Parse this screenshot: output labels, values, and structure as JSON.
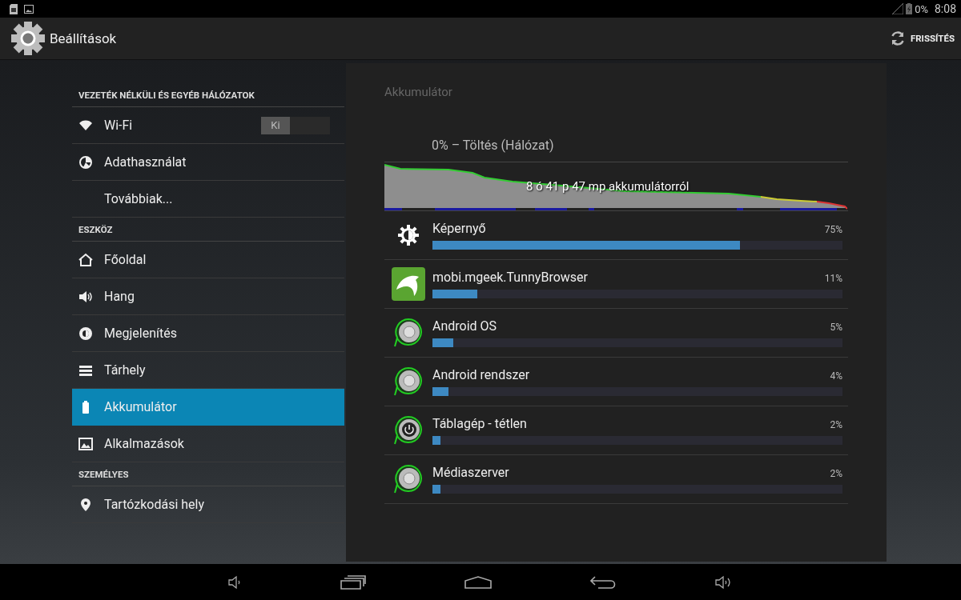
{
  "status_bar": {
    "battery_text": "0%",
    "time": "8:08"
  },
  "action_bar": {
    "title": "Beállítások",
    "action": "FRISSÍTÉS"
  },
  "sidebar": {
    "items": [
      {
        "kind": "header",
        "label": "VEZETÉK NÉLKÜLI ÉS EGYÉB HÁLÓZATOK"
      },
      {
        "kind": "item",
        "label": "Wi-Fi",
        "selected": false,
        "toggle": {
          "label": "Ki",
          "on": false
        }
      },
      {
        "kind": "item",
        "label": "Adathasználat",
        "selected": false
      },
      {
        "kind": "item",
        "label": "Továbbiak...",
        "selected": false
      },
      {
        "kind": "header",
        "label": "ESZKÖZ"
      },
      {
        "kind": "item",
        "label": "Főoldal",
        "selected": false
      },
      {
        "kind": "item",
        "label": "Hang",
        "selected": false
      },
      {
        "kind": "item",
        "label": "Megjelenítés",
        "selected": false
      },
      {
        "kind": "item",
        "label": "Tárhely",
        "selected": false
      },
      {
        "kind": "item",
        "label": "Akkumulátor",
        "selected": true
      },
      {
        "kind": "item",
        "label": "Alkalmazások",
        "selected": false
      },
      {
        "kind": "header",
        "label": "SZEMÉLYES"
      },
      {
        "kind": "item",
        "label": "Tartózkodási hely",
        "selected": false
      }
    ]
  },
  "panel": {
    "title": "Akkumulátor",
    "charge_status": "0% – Töltés (Hálózat)",
    "graph_label": "8 ó 41 p 47 mp akkumulátorról",
    "usage": [
      {
        "name": "Képernyő",
        "percent": "75%",
        "level": 0.75
      },
      {
        "name": "mobi.mgeek.TunnyBrowser",
        "percent": "11%",
        "level": 0.11
      },
      {
        "name": "Android OS",
        "percent": "5%",
        "level": 0.05
      },
      {
        "name": "Android rendszer",
        "percent": "4%",
        "level": 0.04
      },
      {
        "name": "Táblagép - tétlen",
        "percent": "2%",
        "level": 0.02
      },
      {
        "name": "Médiaszerver",
        "percent": "2%",
        "level": 0.02
      }
    ]
  }
}
